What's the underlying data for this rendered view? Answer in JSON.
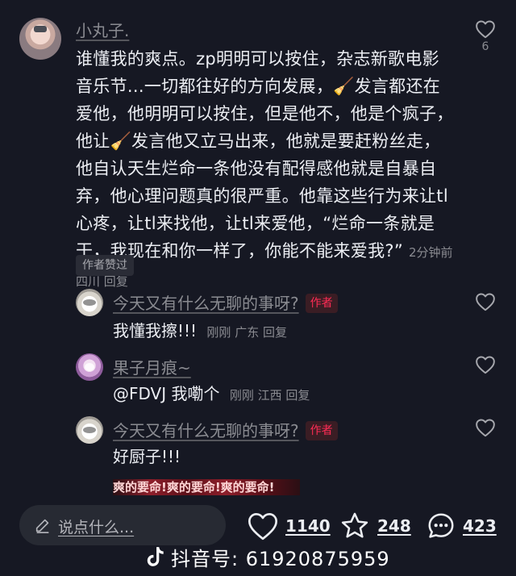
{
  "main_comment": {
    "username": "小丸子.",
    "text": "谁懂我的爽点。zp明明可以按住，杂志新歌电影音乐节...一切都往好的方向发展，🧹发言都还在爱他，他明明可以按住，但是他不，他是个疯子，他让🧹发言他又立马出来，他就是要赶粉丝走，他自认天生烂命一条他没有配得感他就是自暴自弃，他心理问题真的很严重。他靠这些行为来让tl心疼，让tl来找他，让tl来爱他，“烂命一条就是干，我现在和你一样了，你能不能来爱我?”",
    "meta": "2分钟前 四川 回复",
    "like_count": "6",
    "liked_badge": "作者赞过"
  },
  "replies": [
    {
      "username": "今天又有什么无聊的事呀?",
      "author_tag": "作者",
      "text": "我懂我擦!!!",
      "meta": "刚刚 广东 回复"
    },
    {
      "username": "果子月痕~",
      "text": "@FDVJ 我嘞个",
      "meta": "刚刚 江西 回复"
    },
    {
      "username": "今天又有什么无聊的事呀?",
      "author_tag": "作者",
      "text": "好厨子!!!",
      "sticker_text": "爽的要命!爽的要命!爽的要命!"
    }
  ],
  "bottom_bar": {
    "input_placeholder": "说点什么...",
    "likes": "1140",
    "favorites": "248",
    "comments": "423"
  },
  "watermark": {
    "text": "抖音号: 61920875959"
  },
  "icons": {
    "like": "heart-outline-icon",
    "favorite": "star-outline-icon",
    "comment": "chat-bubble-icon",
    "edit": "pencil-icon",
    "brand": "tiktok-logo-icon"
  },
  "colors": {
    "background": "#161823",
    "text": "#eceef3",
    "muted": "#8a8b91",
    "author_tag": "#fe2c55"
  }
}
